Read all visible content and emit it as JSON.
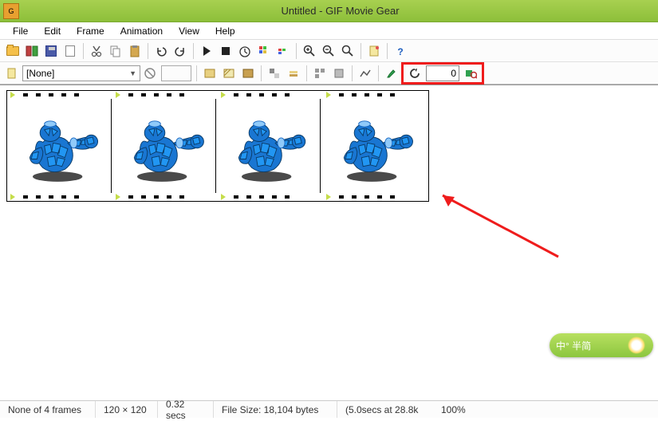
{
  "window": {
    "title": "Untitled - GIF Movie Gear"
  },
  "menu": {
    "file": "File",
    "edit": "Edit",
    "frame": "Frame",
    "animation": "Animation",
    "view": "View",
    "help": "Help"
  },
  "toolbar2": {
    "combo_value": "[None]",
    "loop_value": "0"
  },
  "ime": {
    "label": "中° 半简"
  },
  "status": {
    "frames": "None of 4 frames",
    "dims": "120 × 120",
    "duration": "0.32 secs",
    "filesize": "File Size: 18,104 bytes",
    "rate": "(5.0secs at 28.8k",
    "zoom": "100%"
  },
  "frame_count": 4
}
